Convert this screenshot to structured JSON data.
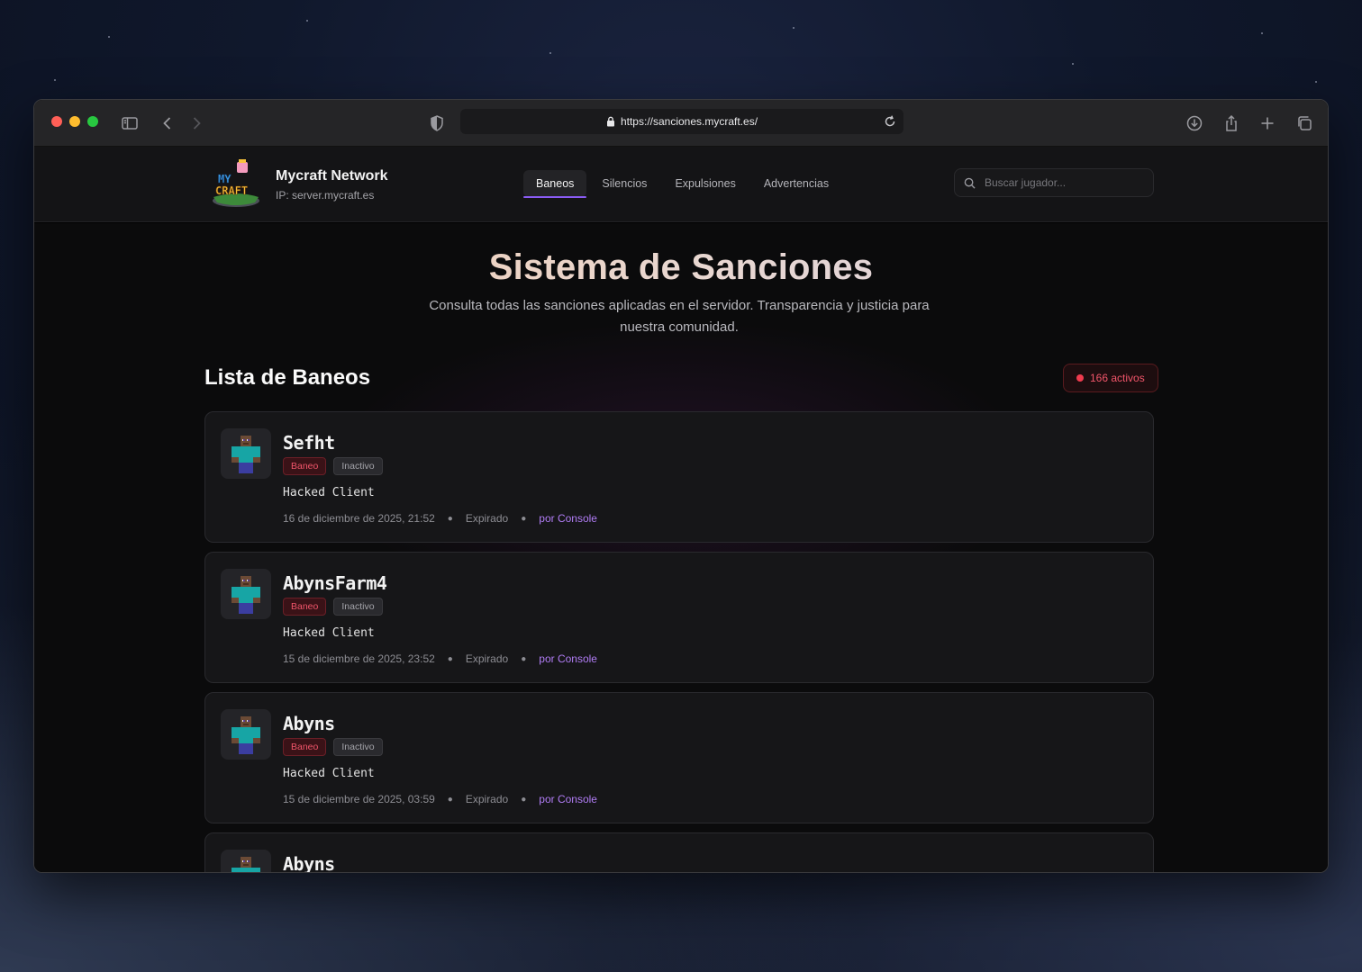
{
  "browser": {
    "url": "https://sanciones.mycraft.es/"
  },
  "site": {
    "brand_name": "Mycraft Network",
    "brand_ip": "IP: server.mycraft.es",
    "logo_text": "MYCRAFT",
    "nav": [
      {
        "label": "Baneos",
        "active": true
      },
      {
        "label": "Silencios",
        "active": false
      },
      {
        "label": "Expulsiones",
        "active": false
      },
      {
        "label": "Advertencias",
        "active": false
      }
    ],
    "search_placeholder": "Buscar jugador..."
  },
  "hero": {
    "title": "Sistema de Sanciones",
    "subtitle": "Consulta todas las sanciones aplicadas en el servidor. Transparencia y justicia para nuestra comunidad."
  },
  "list": {
    "title": "Lista de Baneos",
    "count_label": "166 activos"
  },
  "bans": [
    {
      "name": "Sefht",
      "type": "Baneo",
      "status": "Inactivo",
      "reason": "Hacked Client",
      "date": "16 de diciembre de 2025, 21:52",
      "state": "Expirado",
      "by": "por Console"
    },
    {
      "name": "AbynsFarm4",
      "type": "Baneo",
      "status": "Inactivo",
      "reason": "Hacked Client",
      "date": "15 de diciembre de 2025, 23:52",
      "state": "Expirado",
      "by": "por Console"
    },
    {
      "name": "Abyns",
      "type": "Baneo",
      "status": "Inactivo",
      "reason": "Hacked Client",
      "date": "15 de diciembre de 2025, 03:59",
      "state": "Expirado",
      "by": "por Console"
    },
    {
      "name": "Abyns",
      "type": "",
      "status": "",
      "reason": "",
      "date": "",
      "state": "",
      "by": ""
    }
  ],
  "colors": {
    "accent": "#8b5cf6",
    "ban_red": "#ef3b4e",
    "link_purple": "#b07cf4"
  },
  "icons": [
    "sidebar-icon",
    "back-icon",
    "forward-icon",
    "shield-icon",
    "lock-icon",
    "reload-icon",
    "download-icon",
    "share-icon",
    "new-tab-icon",
    "tabs-overview-icon",
    "search-icon"
  ]
}
